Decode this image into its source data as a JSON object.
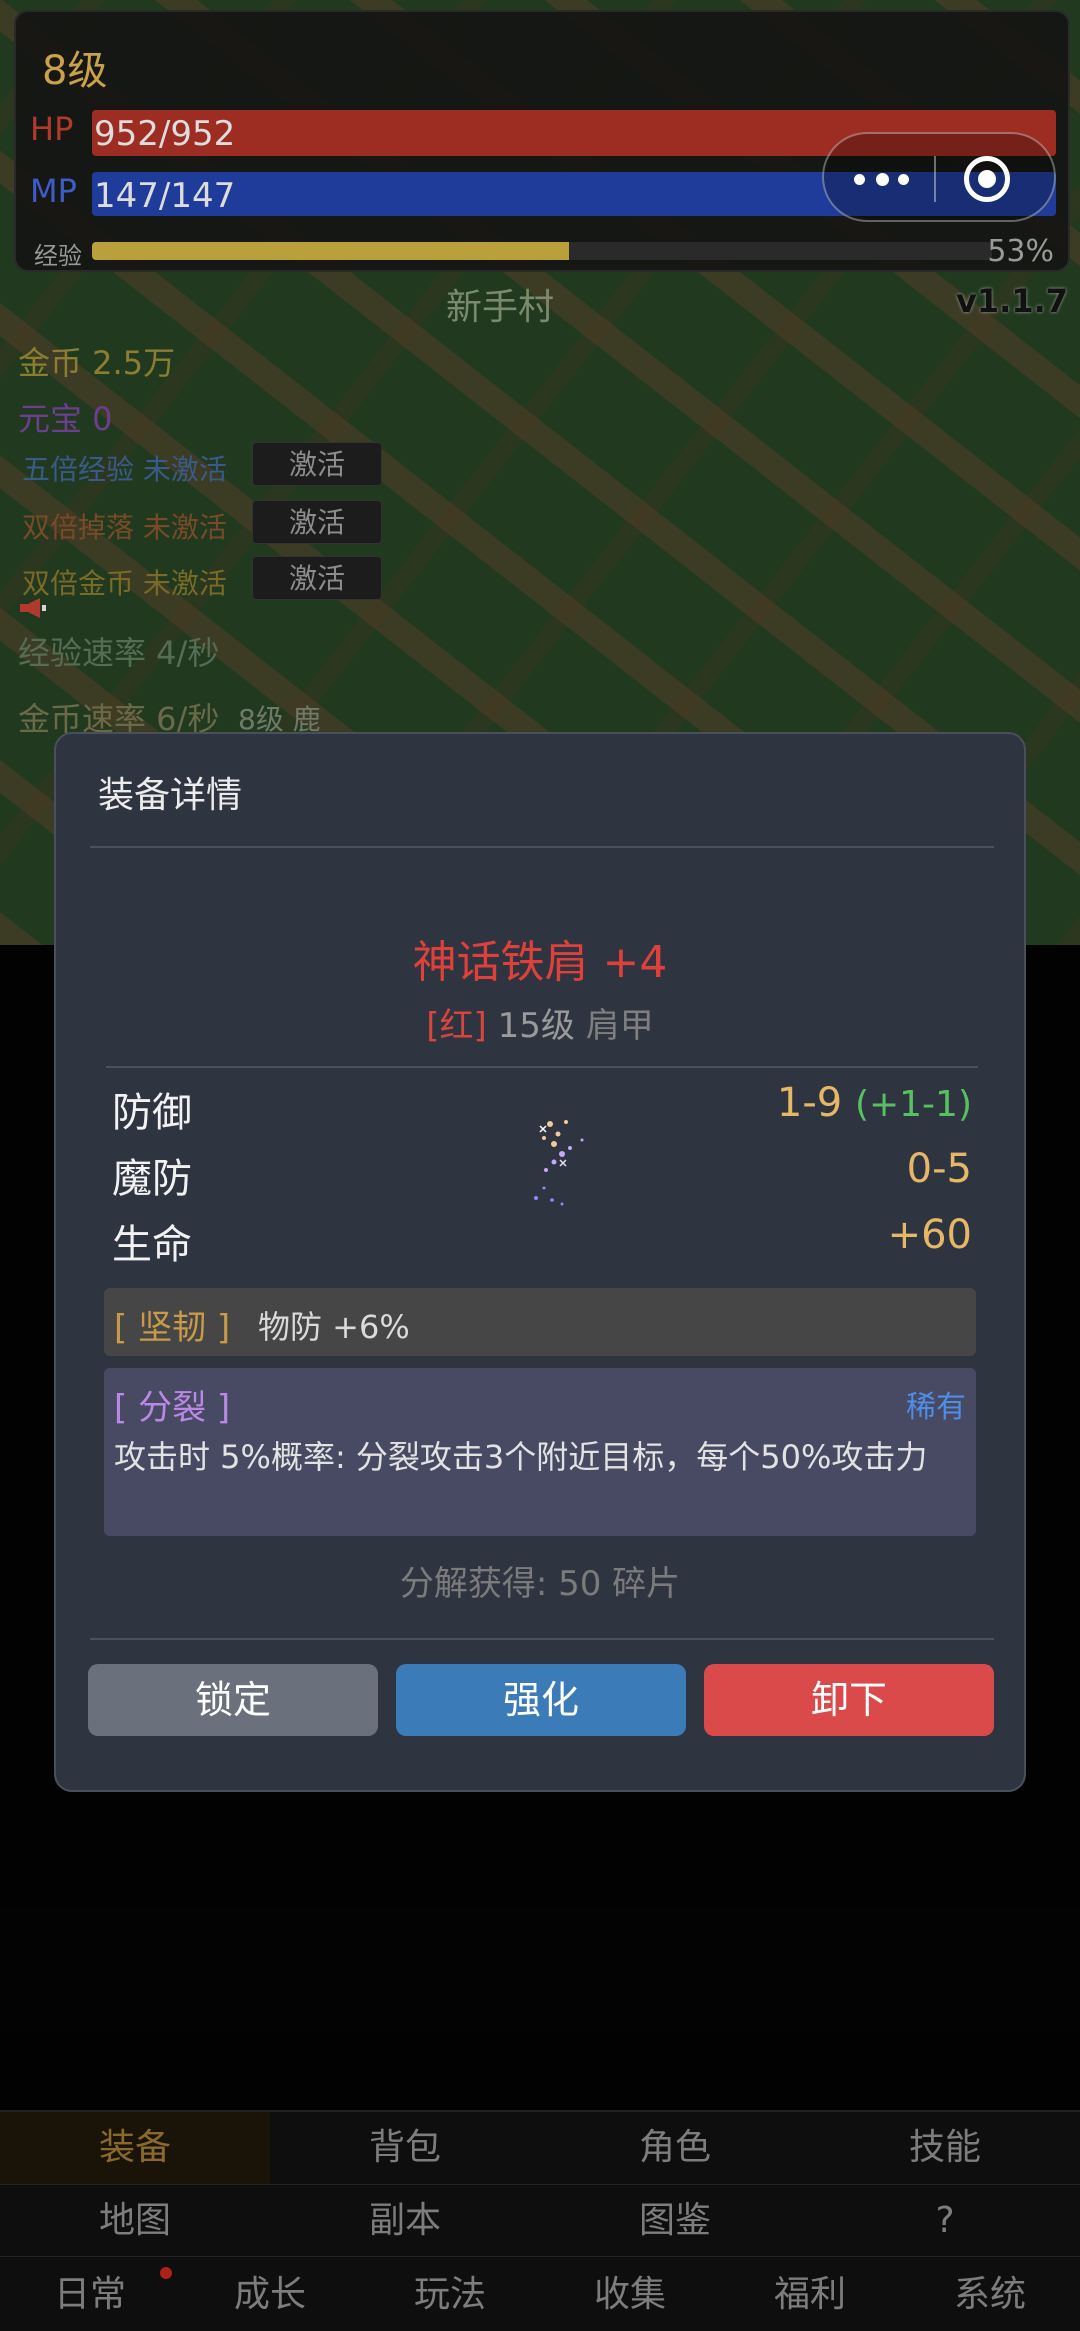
{
  "stats": {
    "level": "8级",
    "hp_label": "HP",
    "hp_value": "952/952",
    "hp_fraction": 1.0,
    "mp_label": "MP",
    "mp_value": "147/147",
    "mp_fraction": 1.0,
    "exp_label": "经验",
    "exp_percent": "53%"
  },
  "map_name": "新手村",
  "version": "v1.1.7",
  "info": {
    "gold": "金币 2.5万",
    "yuanbao": "元宝 0",
    "buffs": [
      {
        "name": "五倍经验 未激活",
        "button": "激活"
      },
      {
        "name": "双倍掉落 未激活",
        "button": "激活"
      },
      {
        "name": "双倍金币 未激活",
        "button": "激活"
      }
    ],
    "exp_rate": "经验速率 4/秒",
    "gold_rate": "金币速率 6/秒",
    "mob": "8级 鹿"
  },
  "modal": {
    "title": "装备详情",
    "item_name": "神话铁肩 +4",
    "quality": "[红]",
    "item_level": "15级",
    "slot": "肩甲",
    "stats": [
      {
        "key": "防御",
        "value": "1-9",
        "bonus": "(+1-1)"
      },
      {
        "key": "魔防",
        "value": "0-5",
        "bonus": ""
      },
      {
        "key": "生命",
        "value": "+60",
        "bonus": ""
      }
    ],
    "trait_name": "[ 坚韧 ]",
    "trait_desc": "物防 +6%",
    "affix_name": "[ 分裂 ]",
    "affix_rarity": "稀有",
    "affix_desc": "攻击时 5%概率: 分裂攻击3个附近目标，每个50%攻击力",
    "salvage": "分解获得: 50 碎片",
    "buttons": {
      "lock": "锁定",
      "enhance": "强化",
      "unequip": "卸下"
    }
  },
  "nav": {
    "row1": [
      "装备",
      "背包",
      "角色",
      "技能"
    ],
    "row2": [
      "地图",
      "副本",
      "图鉴",
      "?"
    ],
    "row3": [
      "日常",
      "成长",
      "玩法",
      "收集",
      "福利",
      "系统"
    ]
  },
  "colors": {
    "modal_bg": "#2f3441",
    "quality_red": "#e0403a",
    "enhance_blue": "#3b7bb8",
    "unequip_red": "#da4a4a",
    "lock_gray": "#6b717c",
    "rarity_blue": "#4f8ee6"
  },
  "icons": [
    "more-dots-icon",
    "target-icon",
    "horn-icon",
    "sparkle-icon"
  ]
}
